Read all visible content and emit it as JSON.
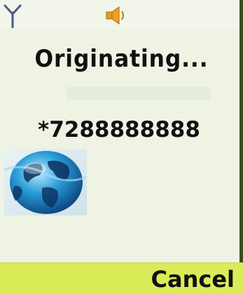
{
  "status_bar": {
    "signal_icon": "signal-antenna-icon",
    "volume_icon": "speaker-icon"
  },
  "call": {
    "status": "Originating...",
    "number": "*7288888888",
    "graphic_icon": "globe-icon"
  },
  "softkeys": {
    "right_label": "Cancel"
  },
  "colors": {
    "screen_bg": "#eef3e4",
    "softkey_bg": "#d9ec58",
    "icon_accent": "#f0a020",
    "globe_blue": "#1e7fc0"
  }
}
